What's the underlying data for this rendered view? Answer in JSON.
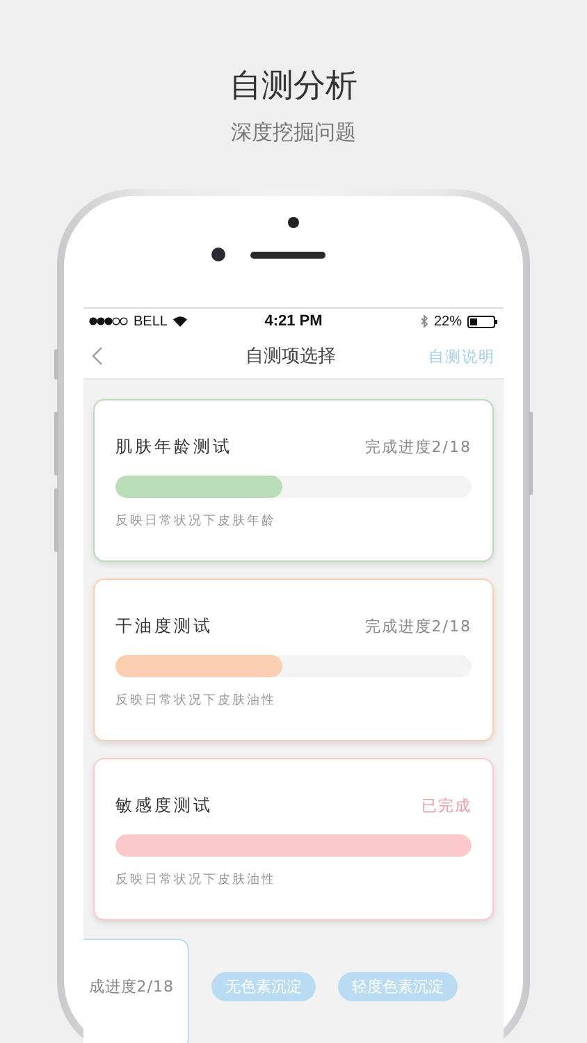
{
  "title": "自测分析",
  "subtitle": "深度挖掘问题",
  "status_bar": {
    "carrier": "BELL",
    "time": "4:21 PM",
    "battery": "22%"
  },
  "nav": {
    "title": "自测项选择",
    "action": "自测说明"
  },
  "tests": [
    {
      "name": "肌肤年龄测试",
      "progress": "完成进度2/18",
      "level": 0.47,
      "description": "反映日常状况下皮肤年龄",
      "color": "#b9ddb6",
      "done": false
    },
    {
      "name": "干油度测试",
      "progress": "完成进度2/18",
      "level": 0.47,
      "description": "反映日常状况下皮肤油性",
      "color": "#fbcfb0",
      "done": false
    },
    {
      "name": "敏感度测试",
      "progress": "已完成",
      "level": 1,
      "description": "反映日常状况下皮肤油性",
      "color": "#fbc9cc",
      "done": true
    }
  ],
  "next_card": {
    "progress": "成进度2/18",
    "color": "#b9dcf2"
  },
  "tags": [
    "无色素沉淀",
    "轻度色素沉淀"
  ]
}
